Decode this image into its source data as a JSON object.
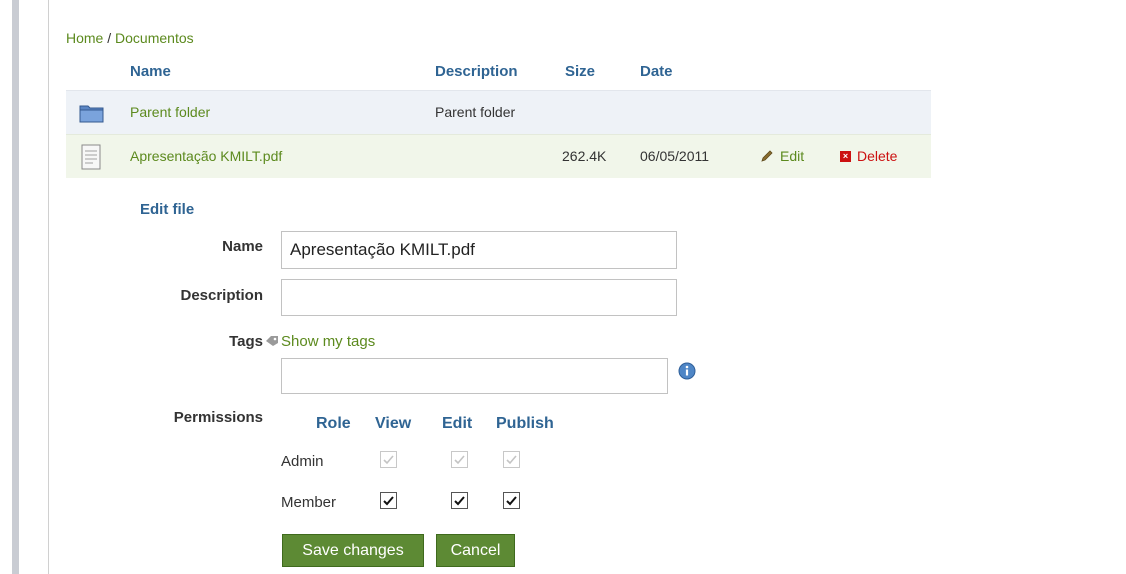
{
  "breadcrumb": {
    "home": "Home",
    "separator": " / ",
    "current": "Documentos"
  },
  "table": {
    "headers": {
      "name": "Name",
      "description": "Description",
      "size": "Size",
      "date": "Date"
    },
    "rows": [
      {
        "icon": "folder-icon",
        "name": "Parent folder",
        "description": "Parent folder",
        "size": "",
        "date": ""
      },
      {
        "icon": "document-icon",
        "name": "Apresentação KMILT.pdf",
        "description": "",
        "size": "262.4K",
        "date": "06/05/2011",
        "edit_label": "Edit",
        "delete_label": "Delete"
      }
    ]
  },
  "edit_form": {
    "title": "Edit file",
    "name_label": "Name",
    "name_value": "Apresentação KMILT.pdf",
    "description_label": "Description",
    "description_value": "",
    "tags_label": "Tags",
    "show_tags_label": "Show my tags",
    "tags_value": "",
    "permissions_label": "Permissions",
    "permissions": {
      "headers": [
        "Role",
        "View",
        "Edit",
        "Publish"
      ],
      "rows": [
        {
          "role": "Admin",
          "view": true,
          "edit": true,
          "publish": true,
          "disabled": true
        },
        {
          "role": "Member",
          "view": true,
          "edit": true,
          "publish": true,
          "disabled": false
        }
      ]
    },
    "save_label": "Save changes",
    "cancel_label": "Cancel"
  },
  "colors": {
    "link_green": "#5c8a1e",
    "header_blue": "#2f6493",
    "delete_red": "#cc1111",
    "button_green": "#5d8a34"
  }
}
